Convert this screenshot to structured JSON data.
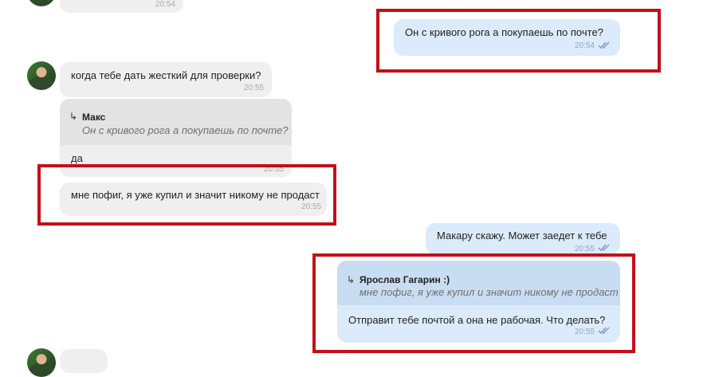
{
  "messages": {
    "m0": {
      "time": "20:54"
    },
    "m1": {
      "text": "Он с кривого рога а покупаешь по почте?",
      "time": "20:54"
    },
    "m2": {
      "text": "когда тебе дать жесткий для проверки?",
      "time": "20:55"
    },
    "m3": {
      "quote_arrow": "↳",
      "quote_author": "Макс",
      "quote_text": "Он с кривого рога а покупаешь по почте?",
      "text": "да",
      "time": "20:55"
    },
    "m4": {
      "text": "мне пофиг, я уже купил и значит никому не продаст",
      "time": "20:55"
    },
    "m5": {
      "text": "Макару скажу. Может заедет к тебе",
      "time": "20:55"
    },
    "m6": {
      "quote_arrow": "↳",
      "quote_author": "Ярослав Гагарин :)",
      "quote_text": "мне пофиг, я уже купил и значит никому не продаст",
      "text": "Отправит тебе почтой а она не рабочая. Что делать?",
      "time": "20:55"
    }
  },
  "colors": {
    "incoming_bubble": "#efefef",
    "outgoing_bubble": "#dcebfb",
    "highlight": "#c40f17",
    "read_ticks": "#7b8fd6"
  },
  "icons": [
    "double-check-icon",
    "reply-arrow-icon",
    "avatar"
  ]
}
